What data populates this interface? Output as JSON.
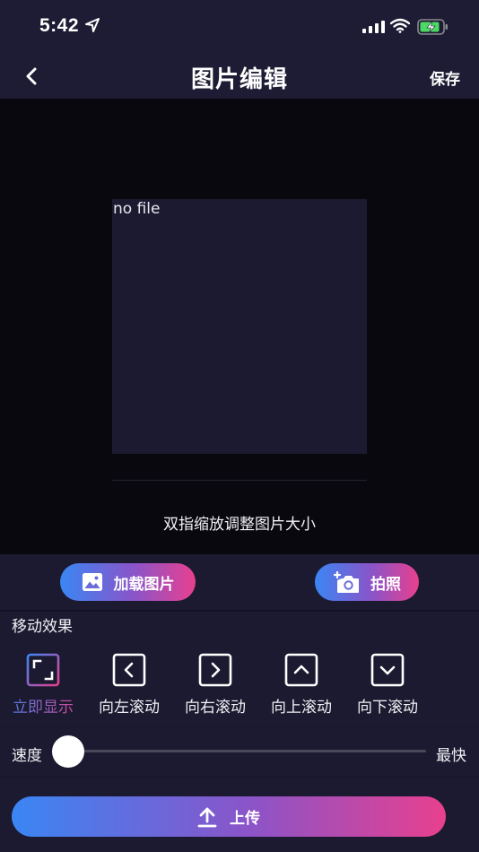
{
  "status_bar": {
    "time": "5:42"
  },
  "nav": {
    "title": "图片编辑",
    "save_label": "保存"
  },
  "canvas": {
    "placeholder": "no file",
    "hint": "双指缩放调整图片大小"
  },
  "actions": {
    "load_label": "加载图片",
    "camera_label": "拍照"
  },
  "effects": {
    "title": "移动效果",
    "items": [
      {
        "label": "立即显示",
        "icon": "show-instantly-icon",
        "active": true
      },
      {
        "label": "向左滚动",
        "icon": "chevron-left-icon",
        "active": false
      },
      {
        "label": "向右滚动",
        "icon": "chevron-right-icon",
        "active": false
      },
      {
        "label": "向上滚动",
        "icon": "chevron-up-icon",
        "active": false
      },
      {
        "label": "向下滚动",
        "icon": "chevron-down-icon",
        "active": false
      }
    ]
  },
  "speed": {
    "label": "速度",
    "max_label": "最快",
    "value": 0
  },
  "upload": {
    "label": "上传"
  },
  "colors": {
    "background": "#1c1a30",
    "canvas": "#09080f",
    "gradient_start": "#3a86f4",
    "gradient_end": "#e8408e"
  }
}
